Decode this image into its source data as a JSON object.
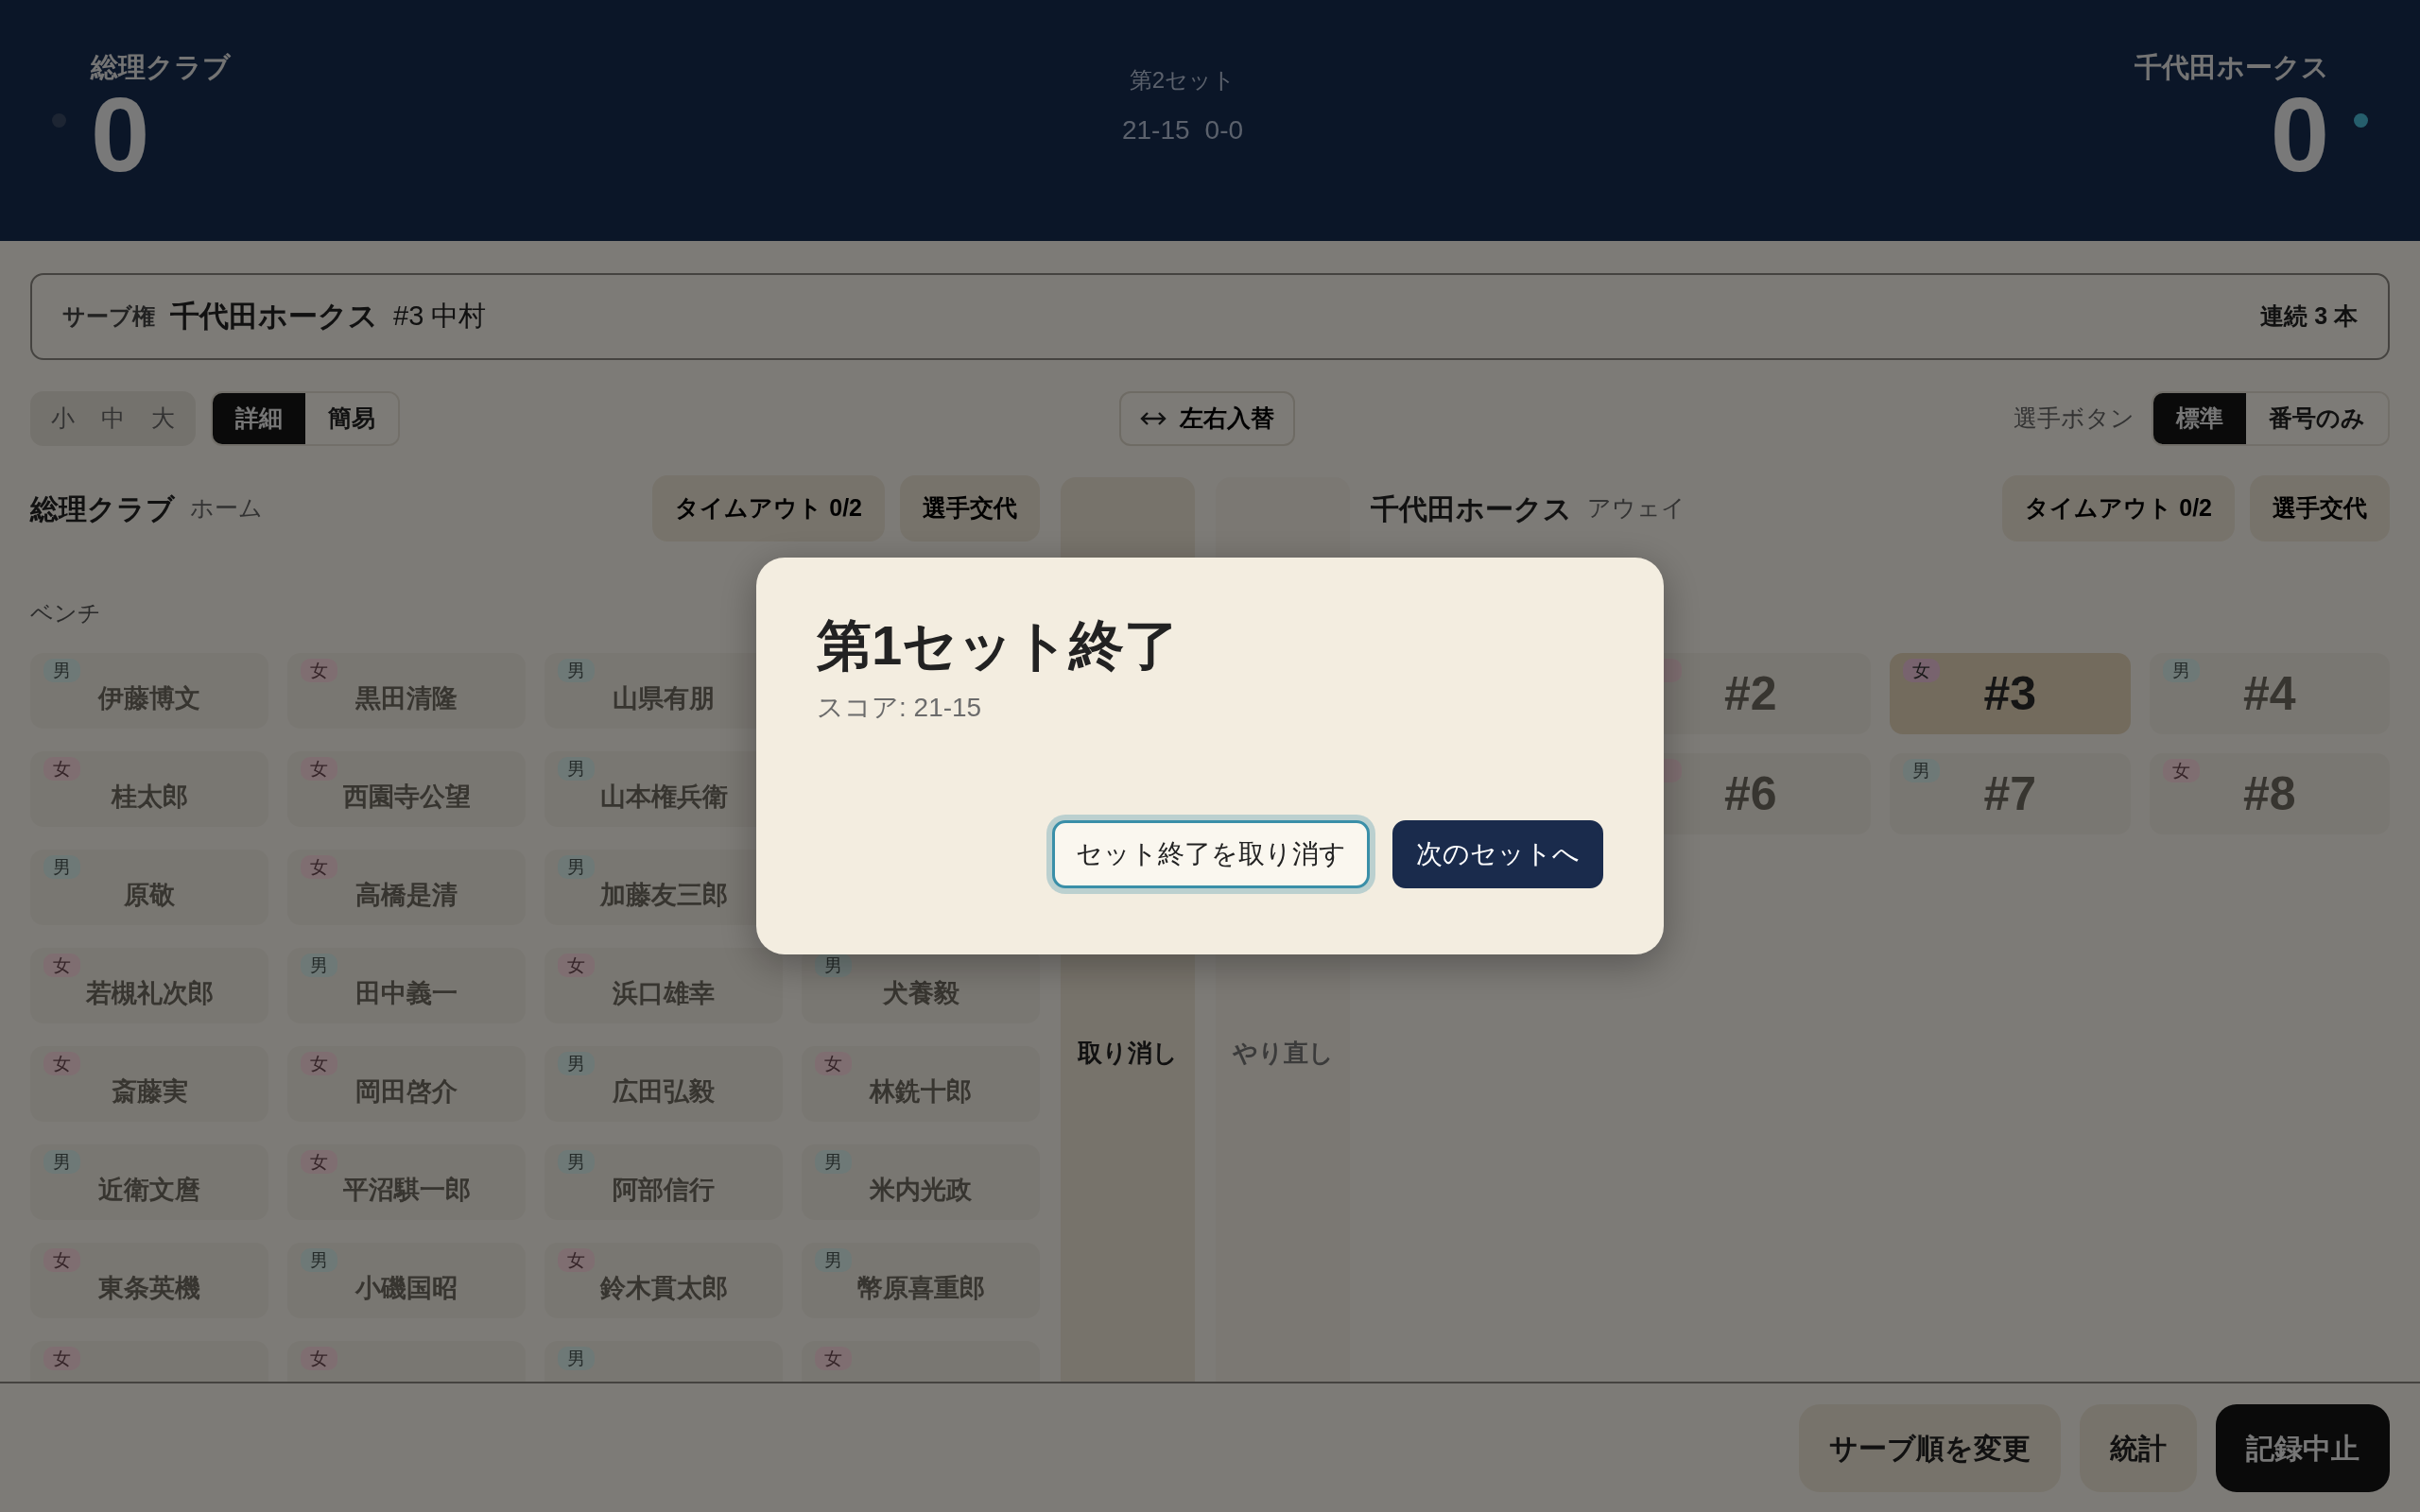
{
  "scoreboard": {
    "teams": [
      {
        "name": "総理クラブ",
        "score": "0",
        "serving": false
      },
      {
        "name": "千代田ホークス",
        "score": "0",
        "serving": true
      }
    ],
    "set_label": "第2セット",
    "set_scores": "21-15",
    "current_score": "0-0"
  },
  "serve_bar": {
    "label": "サーブ権",
    "team": "千代田ホークス",
    "player": "#3 中村",
    "streak": "連続 3 本"
  },
  "toolbar": {
    "size_options": [
      {
        "label": "小",
        "selected": false
      },
      {
        "label": "中",
        "selected": false
      },
      {
        "label": "大",
        "selected": false
      }
    ],
    "view_options": [
      {
        "label": "詳細",
        "selected": true
      },
      {
        "label": "簡易",
        "selected": false
      }
    ],
    "swap_button": "左右入替",
    "button_mode_label": "選手ボタン",
    "button_modes": [
      {
        "label": "標準",
        "selected": true
      },
      {
        "label": "番号のみ",
        "selected": false
      }
    ]
  },
  "home": {
    "name": "総理クラブ",
    "role": "ホーム",
    "timeout": "タイムアウト 0/2",
    "substitution": "選手交代",
    "section": "ベンチ",
    "players": [
      {
        "name": "伊藤博文",
        "badge": "男",
        "kind": "male"
      },
      {
        "name": "黒田清隆",
        "badge": "女",
        "kind": "female"
      },
      {
        "name": "山県有朋",
        "badge": "男",
        "kind": "male"
      },
      {
        "name": "桂太郎",
        "badge": "女",
        "kind": "female"
      },
      {
        "name": "西園寺公望",
        "badge": "女",
        "kind": "female"
      },
      {
        "name": "山本権兵衛",
        "badge": "男",
        "kind": "male"
      },
      {
        "name": "原敬",
        "badge": "男",
        "kind": "male"
      },
      {
        "name": "高橋是清",
        "badge": "女",
        "kind": "female"
      },
      {
        "name": "加藤友三郎",
        "badge": "男",
        "kind": "male"
      },
      {
        "name": "若槻礼次郎",
        "badge": "女",
        "kind": "female"
      },
      {
        "name": "田中義一",
        "badge": "男",
        "kind": "male"
      },
      {
        "name": "浜口雄幸",
        "badge": "女",
        "kind": "female"
      },
      {
        "name": "犬養毅",
        "badge": "男",
        "kind": "male"
      },
      {
        "name": "斎藤実",
        "badge": "女",
        "kind": "female"
      },
      {
        "name": "岡田啓介",
        "badge": "女",
        "kind": "female"
      },
      {
        "name": "広田弘毅",
        "badge": "男",
        "kind": "male"
      },
      {
        "name": "林銑十郎",
        "badge": "女",
        "kind": "female"
      },
      {
        "name": "近衛文麿",
        "badge": "男",
        "kind": "male"
      },
      {
        "name": "平沼騏一郎",
        "badge": "女",
        "kind": "female"
      },
      {
        "name": "阿部信行",
        "badge": "男",
        "kind": "male"
      },
      {
        "name": "米内光政",
        "badge": "男",
        "kind": "male"
      },
      {
        "name": "東条英機",
        "badge": "女",
        "kind": "female"
      },
      {
        "name": "小磯国昭",
        "badge": "男",
        "kind": "male"
      },
      {
        "name": "鈴木貫太郎",
        "badge": "女",
        "kind": "female"
      },
      {
        "name": "幣原喜重郎",
        "badge": "男",
        "kind": "male"
      },
      {
        "badge": "女",
        "kind": "female"
      },
      {
        "badge": "女",
        "kind": "female"
      },
      {
        "badge": "男",
        "kind": "male"
      },
      {
        "badge": "女",
        "kind": "female"
      }
    ]
  },
  "undo": {
    "label": "取り消し",
    "disabled": false
  },
  "redo": {
    "label": "やり直し",
    "disabled": true
  },
  "away": {
    "name": "千代田ホークス",
    "role": "アウェイ",
    "timeout": "タイムアウト 0/2",
    "substitution": "選手交代",
    "players": [
      {
        "number": "#2",
        "kind": "female",
        "serving": false
      },
      {
        "number": "#3",
        "badge": "女",
        "kind": "female",
        "serving": true
      },
      {
        "number": "#4",
        "badge": "男",
        "kind": "male",
        "serving": false
      },
      {
        "number": "#6",
        "kind": "female",
        "serving": false
      },
      {
        "number": "#7",
        "badge": "男",
        "kind": "male",
        "serving": false
      },
      {
        "number": "#8",
        "badge": "女",
        "kind": "female",
        "serving": false
      }
    ]
  },
  "dialog": {
    "title": "第1セット終了",
    "subtitle": "スコア: 21-15",
    "buttons": [
      {
        "label": "セット終了を取り消す",
        "kind": "secondary"
      },
      {
        "label": "次のセットへ",
        "kind": "primary"
      }
    ]
  },
  "footer_buttons": [
    {
      "label": "サーブ順を変更",
      "kind": "secondary"
    },
    {
      "label": "統計",
      "kind": "secondary"
    },
    {
      "label": "記録中止",
      "kind": "primary"
    }
  ]
}
